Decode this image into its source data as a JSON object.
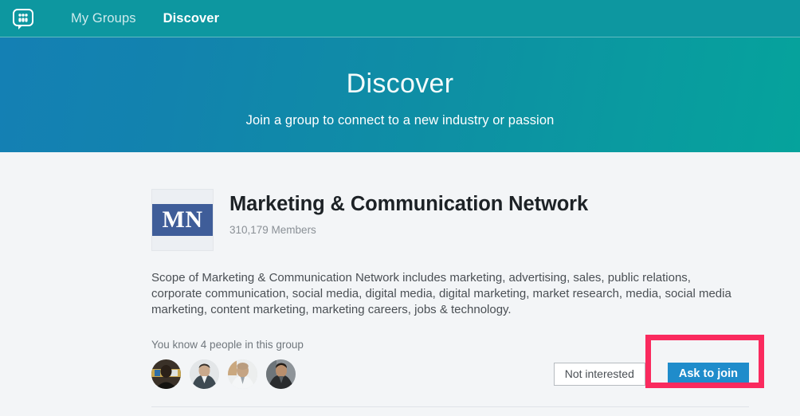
{
  "nav": {
    "logo_icon": "speech-bubble-people-icon",
    "items": [
      {
        "label": "My Groups",
        "active": false
      },
      {
        "label": "Discover",
        "active": true
      }
    ]
  },
  "hero": {
    "title": "Discover",
    "subtitle": "Join a group to connect to a new industry or passion"
  },
  "group": {
    "logo_text": "MN",
    "name": "Marketing & Communication Network",
    "members": "310,179 Members",
    "description": "Scope of Marketing & Communication Network includes marketing, advertising, sales, public relations, corporate communication, social media, digital media, digital marketing, market research, media, social media marketing, content marketing, marketing careers, jobs & technology.",
    "connections_label": "You know 4 people in this group",
    "avatar_count": 4,
    "actions": {
      "not_interested": "Not interested",
      "ask_to_join": "Ask to join"
    }
  },
  "colors": {
    "nav_teal": "#0d97a0",
    "hero_blue": "#1480b4",
    "hero_teal": "#05a39c",
    "highlight_pink": "#fa2a5e",
    "primary_button": "#1f8ccb",
    "logo_band_blue": "#3f5d99",
    "page_background": "#f3f5f7"
  },
  "annotations": [
    {
      "name": "discover-tab-highlight",
      "color": "#fa2a5e"
    },
    {
      "name": "ask-to-join-highlight",
      "color": "#fa2a5e"
    }
  ]
}
